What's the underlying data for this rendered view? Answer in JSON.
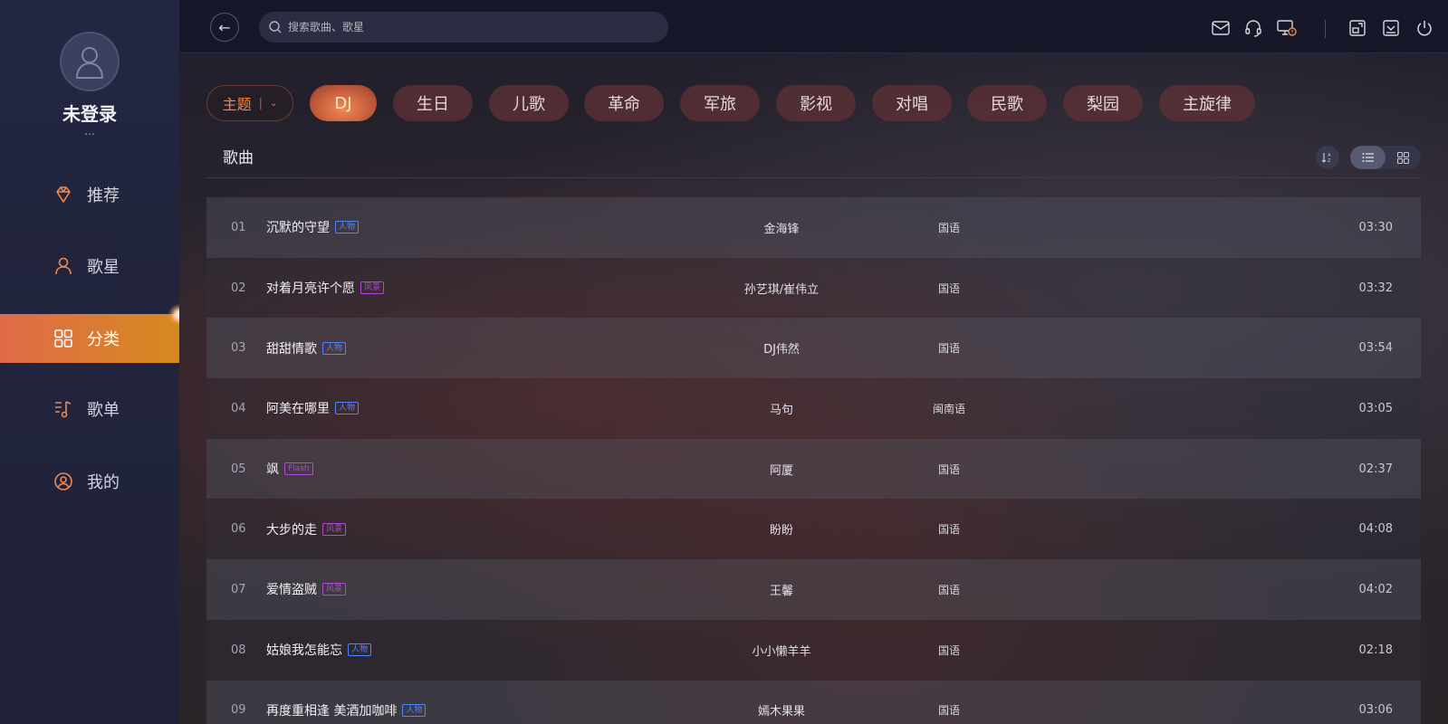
{
  "sidebar": {
    "username": "未登录",
    "user_sub": "...",
    "items": [
      {
        "label": "推荐",
        "icon": "diamond-icon",
        "active": false
      },
      {
        "label": "歌星",
        "icon": "singer-icon",
        "active": false
      },
      {
        "label": "分类",
        "icon": "grid-icon",
        "active": true
      },
      {
        "label": "歌单",
        "icon": "playlist-icon",
        "active": false
      },
      {
        "label": "我的",
        "icon": "user-circle-icon",
        "active": false
      }
    ]
  },
  "topbar": {
    "search_placeholder": "搜索歌曲、歌星",
    "icons": [
      "mail-icon",
      "headset-icon",
      "screen-alert-icon",
      "mini-window-icon",
      "download-icon",
      "power-icon"
    ]
  },
  "categories": {
    "theme_label": "主题",
    "items": [
      {
        "label": "DJ",
        "active": true
      },
      {
        "label": "生日",
        "active": false
      },
      {
        "label": "儿歌",
        "active": false
      },
      {
        "label": "革命",
        "active": false
      },
      {
        "label": "军旅",
        "active": false
      },
      {
        "label": "影视",
        "active": false
      },
      {
        "label": "对唱",
        "active": false
      },
      {
        "label": "民歌",
        "active": false
      },
      {
        "label": "梨园",
        "active": false
      },
      {
        "label": "主旋律",
        "active": false
      }
    ]
  },
  "section": {
    "title": "歌曲"
  },
  "songs": [
    {
      "num": "01",
      "title": "沉默的守望",
      "tag": "人物",
      "tag_color": "blue",
      "artist": "金海锋",
      "lang": "国语",
      "duration": "03:30"
    },
    {
      "num": "02",
      "title": "对着月亮许个愿",
      "tag": "风景",
      "tag_color": "purple",
      "artist": "孙艺琪/崔伟立",
      "lang": "国语",
      "duration": "03:32"
    },
    {
      "num": "03",
      "title": "甜甜情歌",
      "tag": "人物",
      "tag_color": "blue",
      "artist": "DJ伟然",
      "lang": "国语",
      "duration": "03:54"
    },
    {
      "num": "04",
      "title": "阿美在哪里",
      "tag": "人物",
      "tag_color": "blue",
      "artist": "马句",
      "lang": "闽南语",
      "duration": "03:05"
    },
    {
      "num": "05",
      "title": "飒",
      "tag": "Flash",
      "tag_color": "purple",
      "artist": "阿厦",
      "lang": "国语",
      "duration": "02:37"
    },
    {
      "num": "06",
      "title": "大步的走",
      "tag": "风景",
      "tag_color": "purple",
      "artist": "盼盼",
      "lang": "国语",
      "duration": "04:08"
    },
    {
      "num": "07",
      "title": "爱情盗贼",
      "tag": "风景",
      "tag_color": "purple",
      "artist": "王馨",
      "lang": "国语",
      "duration": "04:02"
    },
    {
      "num": "08",
      "title": "姑娘我怎能忘",
      "tag": "人物",
      "tag_color": "blue",
      "artist": "小小懒羊羊",
      "lang": "国语",
      "duration": "02:18"
    },
    {
      "num": "09",
      "title": "再度重相逢 美酒加咖啡",
      "tag": "人物",
      "tag_color": "blue",
      "artist": "嫣木果果",
      "lang": "国语",
      "duration": "03:06"
    }
  ],
  "colors": {
    "accent": "#f0884f",
    "active_nav_start": "#e06a4a",
    "active_nav_end": "#d68a1e"
  }
}
